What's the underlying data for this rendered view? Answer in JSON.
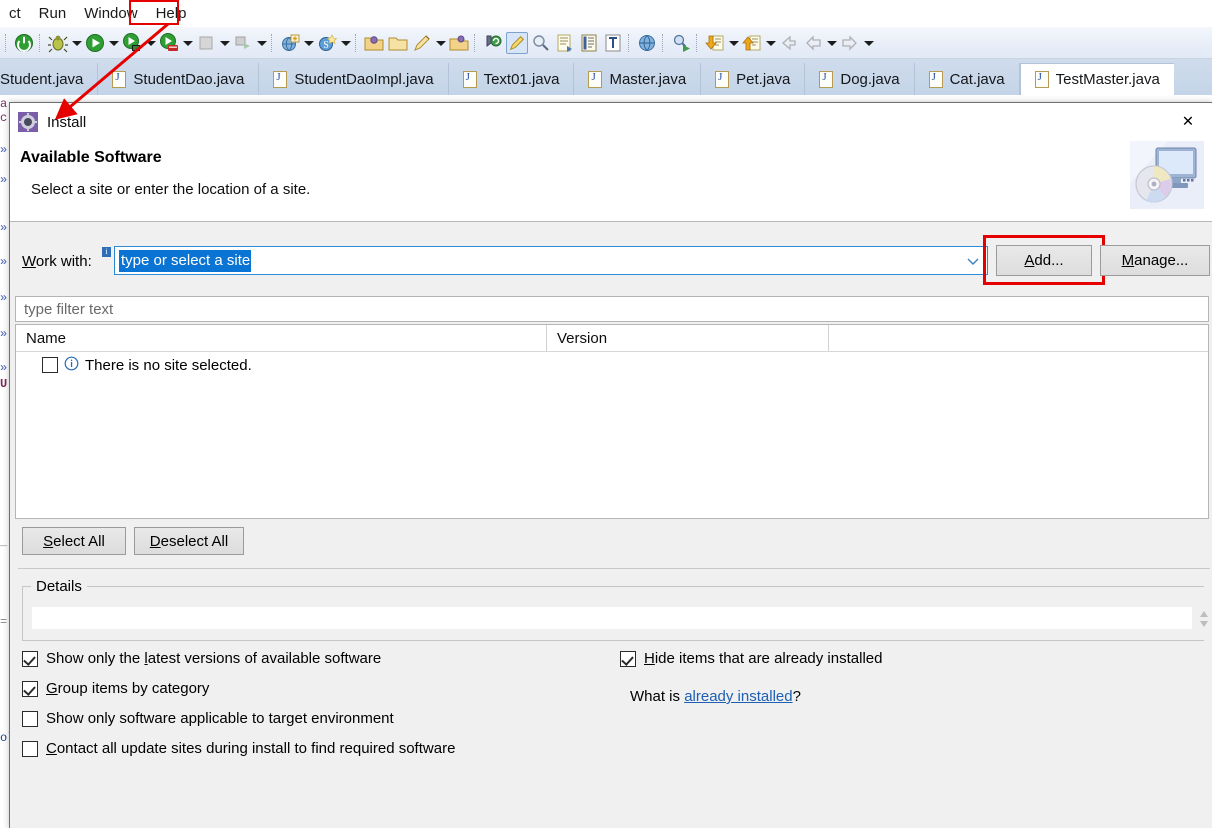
{
  "eclipse": {
    "menu_items": [
      {
        "label": "ct",
        "name": "menu-project-truncated"
      },
      {
        "label": "Run",
        "name": "menu-run"
      },
      {
        "label": "Window",
        "name": "menu-window"
      },
      {
        "label": "Help",
        "name": "menu-help"
      }
    ],
    "highlight_color": "#e60000",
    "tabs": [
      {
        "label": "Student.java",
        "active": false,
        "truncated": true
      },
      {
        "label": "StudentDao.java",
        "active": false
      },
      {
        "label": "StudentDaoImpl.java",
        "active": false
      },
      {
        "label": "Text01.java",
        "active": false
      },
      {
        "label": "Master.java",
        "active": false
      },
      {
        "label": "Pet.java",
        "active": false
      },
      {
        "label": "Dog.java",
        "active": false
      },
      {
        "label": "Cat.java",
        "active": false
      },
      {
        "label": "TestMaster.java",
        "active": true
      }
    ]
  },
  "dialog": {
    "title": "Install",
    "title_icon": "install-gear-icon",
    "close_label": "✕",
    "banner": {
      "heading": "Available Software",
      "subtext": "Select a site or enter the location of a site.",
      "graphic": "computer-disc-graphic"
    },
    "work_with": {
      "label_prefix": "W",
      "label_rest": "ork with:",
      "info_badge": "i",
      "value": "type or select a site",
      "add_button": {
        "mnemonic": "A",
        "rest": "dd...",
        "highlighted": true
      },
      "manage_button": {
        "mnemonic": "M",
        "rest": "anage..."
      }
    },
    "filter": {
      "placeholder": "type filter text",
      "value": ""
    },
    "table": {
      "columns": [
        "Name",
        "Version",
        ""
      ],
      "rows": [
        {
          "checked": false,
          "icon": "info-icon",
          "name": "There is no site selected.",
          "version": ""
        }
      ]
    },
    "select_all_button": {
      "mnemonic": "S",
      "rest": "elect All"
    },
    "deselect_all_button": {
      "mnemonic": "D",
      "rest": "eselect All"
    },
    "details": {
      "legend": "Details",
      "value": ""
    },
    "options": {
      "left": [
        {
          "checked": true,
          "pre": "Show only the ",
          "mnemonic": "l",
          "post": "atest versions of available software",
          "name": "show-latest-versions-checkbox"
        },
        {
          "checked": true,
          "pre": "",
          "mnemonic": "G",
          "post": "roup items by category",
          "name": "group-by-category-checkbox"
        },
        {
          "checked": false,
          "pre": "Show only software applicable to target environment",
          "mnemonic": "",
          "post": "",
          "name": "show-applicable-software-checkbox"
        },
        {
          "checked": false,
          "pre": "",
          "mnemonic": "C",
          "post": "ontact all update sites during install to find required software",
          "name": "contact-update-sites-checkbox"
        }
      ],
      "right": [
        {
          "checked": true,
          "pre": "",
          "mnemonic": "H",
          "post": "ide items that are already installed",
          "name": "hide-installed-checkbox"
        }
      ],
      "what_is_prefix": "What is ",
      "what_is_link": "already installed",
      "what_is_suffix": "?"
    }
  }
}
